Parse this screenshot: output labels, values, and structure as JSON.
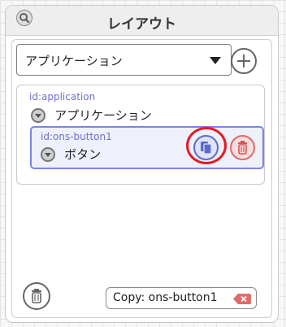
{
  "header": {
    "title": "レイアウト",
    "search_icon": "magnifier-icon"
  },
  "selector": {
    "selected": "アプリケーション",
    "options": [
      "アプリケーション"
    ]
  },
  "tree": {
    "root": {
      "id_label": "id:application",
      "label": "アプリケーション"
    },
    "child": {
      "id_label": "id:ons-button1",
      "label": "ボタン",
      "selected": true
    }
  },
  "footer": {
    "clipboard_text": "Copy: ons-button1"
  },
  "colors": {
    "accent": "#7b84e4",
    "node_id_text": "#6f6fd1",
    "delete": "#e06b6b",
    "highlight_ring": "#e01c24"
  }
}
